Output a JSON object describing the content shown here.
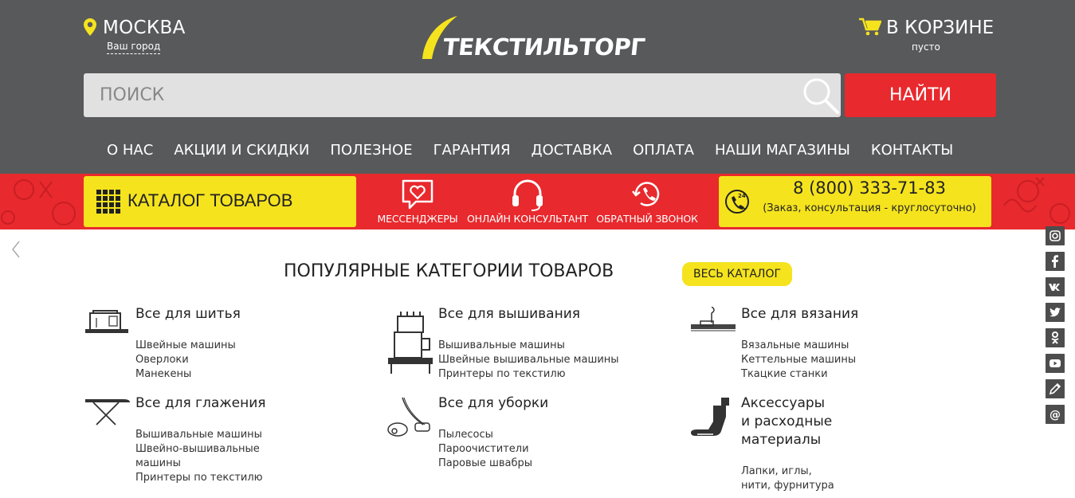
{
  "header": {
    "city": {
      "name": "МОСКВА",
      "sub": "Ваш город"
    },
    "logo_text": "ТЕКСТИЛЬТОРГ",
    "cart": {
      "label": "В КОРЗИНЕ",
      "sub": "пусто"
    },
    "search": {
      "placeholder": "ПОИСК",
      "button": "НАЙТИ"
    },
    "nav": [
      "О НАС",
      "АКЦИИ И СКИДКИ",
      "ПОЛЕЗНОЕ",
      "ГАРАНТИЯ",
      "ДОСТАВКА",
      "ОПЛАТА",
      "НАШИ МАГАЗИНЫ",
      "КОНТАКТЫ"
    ]
  },
  "redbar": {
    "catalog": "КАТАЛОГ ТОВАРОВ",
    "messengers": "МЕССЕНДЖЕРЫ",
    "consultant": "ОНЛАЙН КОНСУЛЬТАНТ",
    "callback": "ОБРАТНЫЙ ЗВОНОК",
    "phone": "8 (800) 333-71-83",
    "phone_note": "(Заказ, консультация - круглосуточно)"
  },
  "social_icons": [
    "instagram-icon",
    "facebook-icon",
    "vk-icon",
    "twitter-icon",
    "odnoklassniki-icon",
    "youtube-icon",
    "pencil-icon",
    "email-icon"
  ],
  "popular": {
    "title": "ПОПУЛЯРНЫЕ КАТЕГОРИИ ТОВАРОВ",
    "all_catalog": "ВЕСЬ КАТАЛОГ",
    "categories": [
      {
        "title": "Все для шитья",
        "icon": "sewing-machine-icon",
        "links": [
          "Швейные машины",
          "Оверлоки",
          "Манекены"
        ]
      },
      {
        "title": "Все для вышивания",
        "icon": "embroidery-machine-icon",
        "links": [
          "Вышивальные машины",
          "Швейные вышивальные машины",
          "Принтеры по текстилю"
        ]
      },
      {
        "title": "Все для вязания",
        "icon": "knitting-machine-icon",
        "links": [
          "Вязальные машины",
          "Кеттельные машины",
          "Ткацкие станки"
        ]
      },
      {
        "title": "Все для глажения",
        "icon": "ironing-board-icon",
        "links": [
          "Вышивальные машины",
          "Швейно-вышивальные",
          "машины",
          "Принтеры по текстилю"
        ]
      },
      {
        "title": "Все для уборки",
        "icon": "vacuum-cleaner-icon",
        "links": [
          "Пылесосы",
          "Пароочистители",
          "Паровые швабры"
        ]
      },
      {
        "title": "Аксессуары",
        "title2": "и расходные",
        "title3": "материалы",
        "icon": "presser-foot-icon",
        "links": [
          "Лапки, иглы,",
          "нити, фурнитура"
        ]
      }
    ]
  },
  "colors": {
    "header_bg": "#58595b",
    "accent_yellow": "#f5e31e",
    "accent_red": "#e8292d"
  }
}
